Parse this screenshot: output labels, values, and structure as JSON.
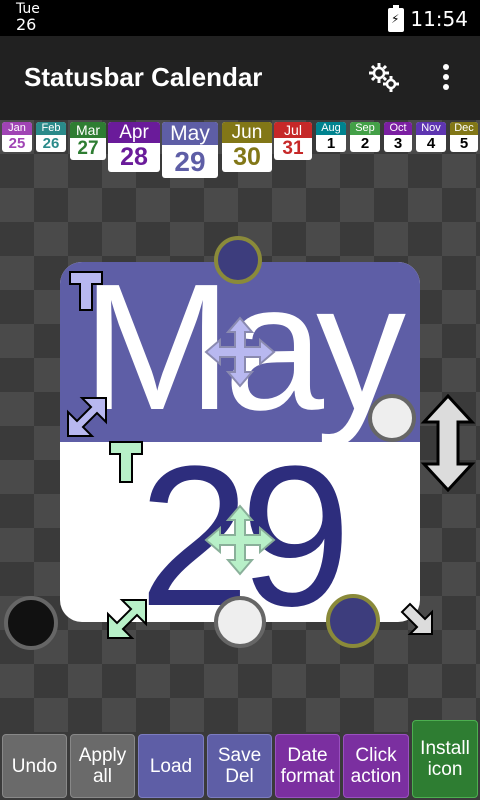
{
  "status_bar": {
    "day_name": "Tue",
    "day_num": "26",
    "time": "11:54"
  },
  "app_bar": {
    "title": "Statusbar Calendar",
    "settings_icon": "gear-icon",
    "menu_icon": "more-vert-icon"
  },
  "months": [
    {
      "name": "Jan",
      "day": "25",
      "color": "#a044b4"
    },
    {
      "name": "Feb",
      "day": "26",
      "color": "#2a8a8a"
    },
    {
      "name": "Mar",
      "day": "27",
      "color": "#2e7d32"
    },
    {
      "name": "Apr",
      "day": "28",
      "color": "#6a1b9a"
    },
    {
      "name": "May",
      "day": "29",
      "color": "#5e5ea6"
    },
    {
      "name": "Jun",
      "day": "30",
      "color": "#827717"
    },
    {
      "name": "Jul",
      "day": "31",
      "color": "#c62828"
    },
    {
      "name": "Aug",
      "day": "1",
      "color": "#00838f"
    },
    {
      "name": "Sep",
      "day": "2",
      "color": "#43a047"
    },
    {
      "name": "Oct",
      "day": "3",
      "color": "#7b1fa2"
    },
    {
      "name": "Nov",
      "day": "4",
      "color": "#5e35b1"
    },
    {
      "name": "Dec",
      "day": "5",
      "color": "#827717"
    }
  ],
  "calendar": {
    "month": "May",
    "day": "29",
    "header_color": "#5e5ea6",
    "day_color": "#2d2d7d"
  },
  "buttons": {
    "undo": "Undo",
    "apply_all": "Apply all",
    "load": "Load",
    "save_del": "Save Del",
    "date_format": "Date format",
    "click_action": "Click action",
    "install_icon": "Install icon"
  }
}
